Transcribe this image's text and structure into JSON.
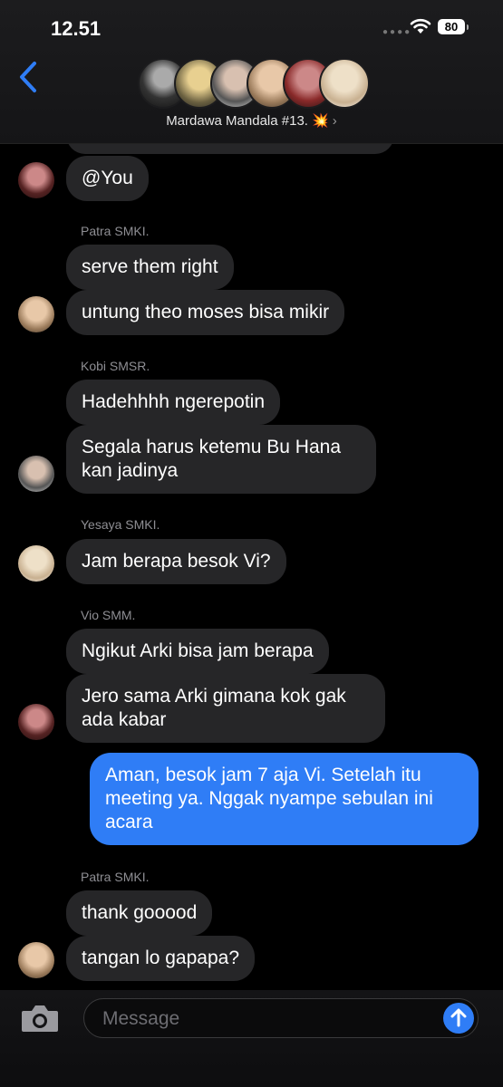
{
  "status": {
    "time": "12.51",
    "battery": "80"
  },
  "header": {
    "group_name": "Mardawa Mandala #13. 💥",
    "chevron": "›",
    "back_icon": "chevron-left-icon"
  },
  "colors": {
    "accent": "#2f7df6",
    "bubble_in": "#262628",
    "bubble_out": "#2f7df6",
    "background": "#000000"
  },
  "messages": [
    {
      "text": "@You"
    },
    {
      "sender": "Patra SMKI."
    },
    {
      "text": "serve them right"
    },
    {
      "text": "untung theo moses bisa mikir"
    },
    {
      "sender": "Kobi SMSR."
    },
    {
      "text": "Hadehhhh ngerepotin"
    },
    {
      "text": "Segala harus ketemu Bu Hana kan jadinya"
    },
    {
      "sender": "Yesaya SMKI."
    },
    {
      "text": "Jam berapa besok Vi?"
    },
    {
      "sender": "Vio SMM."
    },
    {
      "text": "Ngikut Arki bisa jam berapa"
    },
    {
      "text": "Jero sama Arki gimana kok gak ada kabar"
    },
    {
      "text": "Aman, besok jam 7 aja Vi. Setelah itu meeting ya. Nggak nyampe sebulan ini acara"
    },
    {
      "sender": "Patra SMKI."
    },
    {
      "text": "thank gooood"
    },
    {
      "text": "tangan lo gapapa?"
    }
  ],
  "composer": {
    "placeholder": "Message",
    "camera_icon": "camera-icon",
    "send_icon": "send-arrow-icon"
  }
}
